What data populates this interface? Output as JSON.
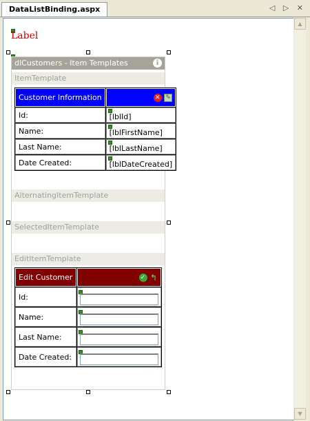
{
  "tab": {
    "title": "DataListBinding.aspx"
  },
  "nav": {
    "prev": "◁",
    "next": "▷",
    "close": "✕"
  },
  "label_control": {
    "text": "Label"
  },
  "datalist": {
    "header": "dlCustomers - Item Templates",
    "templates": {
      "item": "ItemTemplate",
      "alternating": "AlternatingItemTemplate",
      "selected": "SelectedItemTemplate",
      "edit": "EditItemTemplate"
    },
    "item_table": {
      "title": "Customer Information",
      "rows": [
        {
          "label": "Id:",
          "value": "lblId]"
        },
        {
          "label": "Name:",
          "value": "lblFirstName]"
        },
        {
          "label": "Last Name:",
          "value": "lblLastName]"
        },
        {
          "label": "Date Created:",
          "value": "lblDateCreated]"
        }
      ]
    },
    "edit_table": {
      "title": "Edit Customer",
      "rows": [
        {
          "label": "Id:"
        },
        {
          "label": "Name:"
        },
        {
          "label": "Last Name:"
        },
        {
          "label": "Date Created:"
        }
      ]
    }
  },
  "colors": {
    "item_header": "#0000ff",
    "edit_header": "#800000",
    "label_text": "#cc0000"
  }
}
